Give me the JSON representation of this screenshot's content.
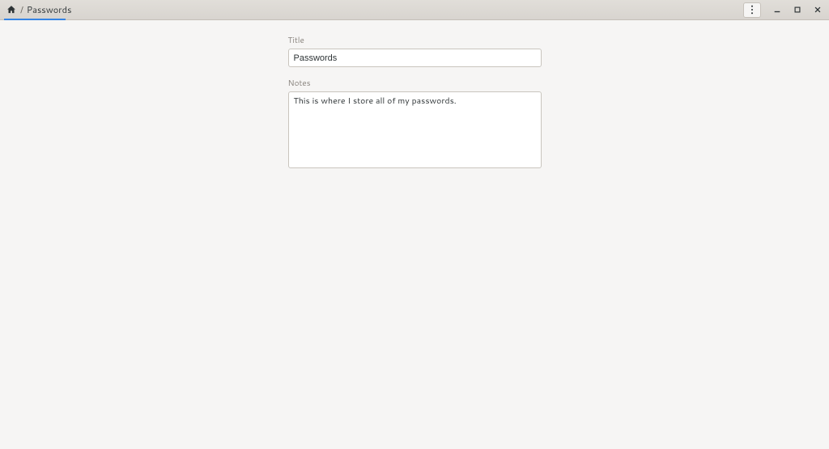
{
  "breadcrumb": {
    "separator": "/",
    "current": "Passwords"
  },
  "form": {
    "title_label": "Title",
    "title_value": "Passwords",
    "notes_label": "Notes",
    "notes_value": "This is where I store all of my passwords."
  }
}
